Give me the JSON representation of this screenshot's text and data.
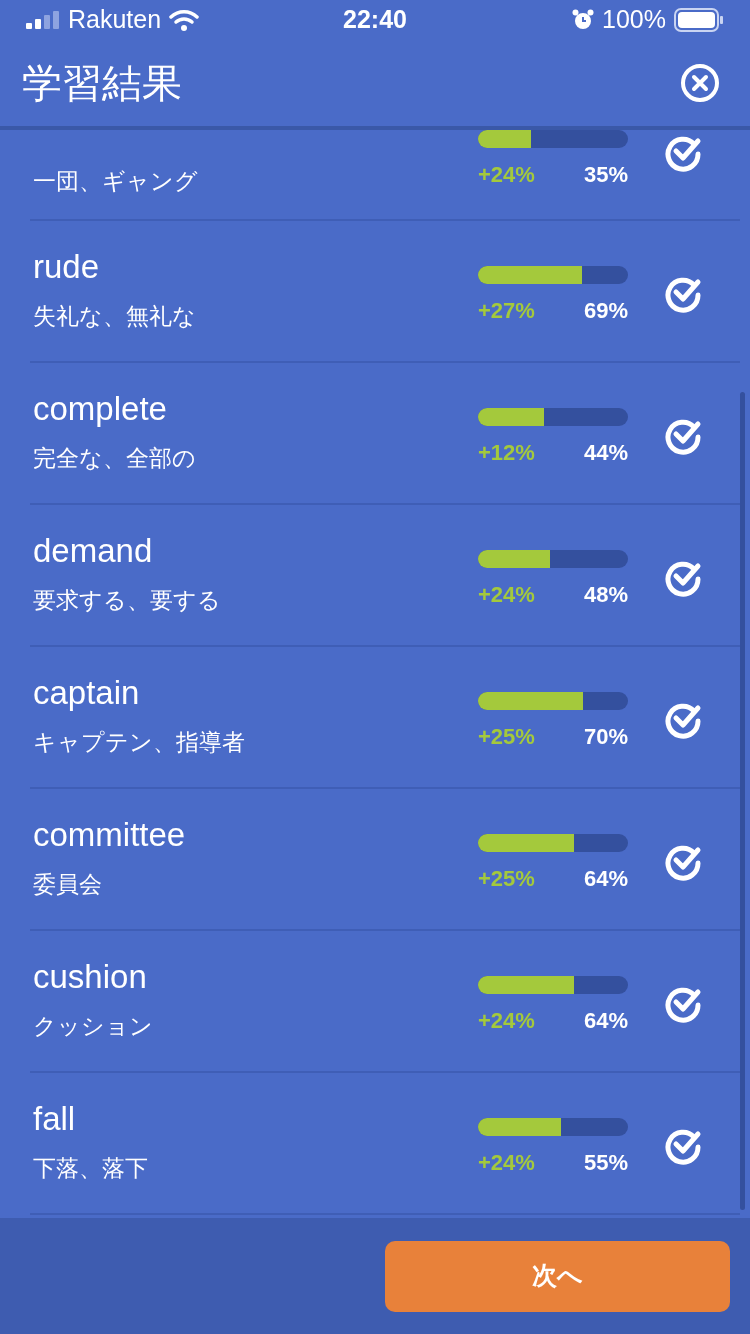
{
  "status_bar": {
    "carrier": "Rakuten",
    "time": "22:40",
    "battery": "100%"
  },
  "header": {
    "title": "学習結果"
  },
  "results": [
    {
      "translation": "一団、ギャング",
      "level": 0.35,
      "gain": "+24%",
      "percent": "35%",
      "checked": true
    },
    {
      "word": "rude",
      "translation": "失礼な、無礼な",
      "level": 0.69,
      "gain": "+27%",
      "percent": "69%",
      "checked": true
    },
    {
      "word": "complete",
      "translation": "完全な、全部の",
      "level": 0.44,
      "gain": "+12%",
      "percent": "44%",
      "checked": true
    },
    {
      "word": "demand",
      "translation": "要求する、要する",
      "level": 0.48,
      "gain": "+24%",
      "percent": "48%",
      "checked": true
    },
    {
      "word": "captain",
      "translation": "キャプテン、指導者",
      "level": 0.7,
      "gain": "+25%",
      "percent": "70%",
      "checked": true
    },
    {
      "word": "committee",
      "translation": "委員会",
      "level": 0.64,
      "gain": "+25%",
      "percent": "64%",
      "checked": true
    },
    {
      "word": "cushion",
      "translation": "クッション",
      "level": 0.64,
      "gain": "+24%",
      "percent": "64%",
      "checked": true
    },
    {
      "word": "fall",
      "translation": "下落、落下",
      "level": 0.55,
      "gain": "+24%",
      "percent": "55%",
      "checked": true
    }
  ],
  "next_button": "次へ"
}
